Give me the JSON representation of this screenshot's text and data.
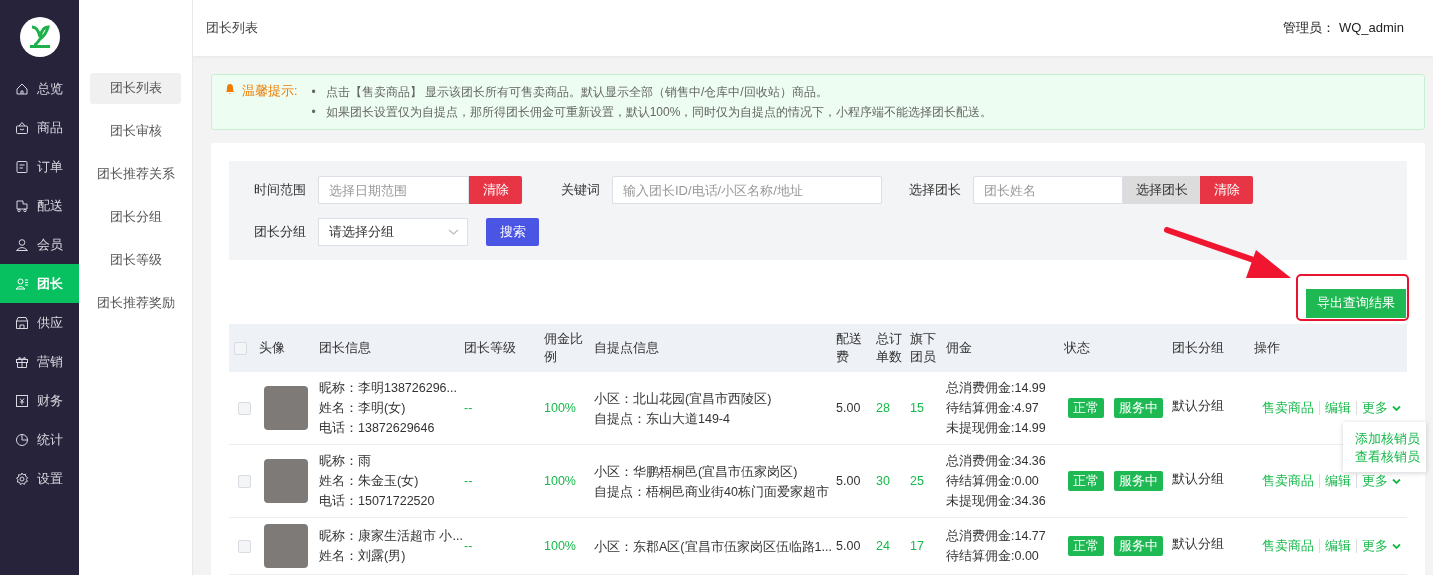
{
  "sidebar": {
    "items": [
      {
        "label": "总览",
        "kind": "home",
        "selected": false
      },
      {
        "label": "商品",
        "kind": "bag",
        "selected": false
      },
      {
        "label": "订单",
        "kind": "order",
        "selected": false
      },
      {
        "label": "配送",
        "kind": "truck",
        "selected": false
      },
      {
        "label": "会员",
        "kind": "user",
        "selected": false
      },
      {
        "label": "团长",
        "kind": "leader",
        "selected": true
      },
      {
        "label": "供应",
        "kind": "store",
        "selected": false
      },
      {
        "label": "营销",
        "kind": "gift",
        "selected": false
      },
      {
        "label": "财务",
        "kind": "finance",
        "selected": false
      },
      {
        "label": "统计",
        "kind": "chart",
        "selected": false
      },
      {
        "label": "设置",
        "kind": "gear",
        "selected": false
      }
    ]
  },
  "subnav": {
    "items": [
      {
        "label": "团长列表",
        "selected": true
      },
      {
        "label": "团长审核",
        "selected": false
      },
      {
        "label": "团长推荐关系",
        "selected": false
      },
      {
        "label": "团长分组",
        "selected": false
      },
      {
        "label": "团长等级",
        "selected": false
      },
      {
        "label": "团长推荐奖励",
        "selected": false
      }
    ]
  },
  "header": {
    "title": "团长列表",
    "admin": "管理员： WQ_admin"
  },
  "notice": {
    "title": "温馨提示:",
    "bullet": "•",
    "items": [
      "点击【售卖商品】 显示该团长所有可售卖商品。默认显示全部（销售中/仓库中/回收站）商品。",
      "如果团长设置仅为自提点，那所得团长佣金可重新设置，默认100%，同时仅为自提点的情况下，小程序端不能选择团长配送。"
    ]
  },
  "filters": {
    "time_label": "时间范围",
    "time_placeholder": "选择日期范围",
    "time_clear": "清除",
    "keyword_label": "关键词",
    "keyword_placeholder": "输入团长ID/电话/小区名称/地址",
    "leader_label": "选择团长",
    "leader_placeholder": "团长姓名",
    "leader_select": "选择团长",
    "leader_clear": "清除",
    "group_label": "团长分组",
    "group_value": "请选择分组",
    "search": "搜索"
  },
  "export_button": "导出查询结果",
  "table": {
    "header_checked": false,
    "columns": [
      "头像",
      "团长信息",
      "团长等级",
      "佣金比例",
      "自提点信息",
      "配送费",
      "总订单数",
      "旗下团员",
      "佣金",
      "状态",
      "团长分组",
      "操作"
    ],
    "rows": [
      {
        "checked": false,
        "info": [
          "昵称：李明138726296...",
          "姓名：李明(女)",
          "电话：13872629646"
        ],
        "level": "--",
        "ratio": "100%",
        "pickup": [
          "小区：北山花园(宜昌市西陵区)",
          "自提点：东山大道149-4"
        ],
        "delivery_fee": "5.00",
        "orders": "28",
        "members": "15",
        "commission": [
          "总消费佣金:14.99",
          "待结算佣金:4.97",
          "未提现佣金:14.99"
        ],
        "tags": [
          "正常",
          "服务中"
        ],
        "group": "默认分组",
        "actions": [
          "售卖商品",
          "编辑",
          "更多"
        ]
      },
      {
        "checked": false,
        "info": [
          "昵称：雨",
          "姓名：朱金玉(女)",
          "电话：15071722520"
        ],
        "level": "--",
        "ratio": "100%",
        "pickup": [
          "小区：华鹏梧桐邑(宜昌市伍家岗区)",
          "自提点：梧桐邑商业街40栋门面爱家超市"
        ],
        "delivery_fee": "5.00",
        "orders": "30",
        "members": "25",
        "commission": [
          "总消费佣金:34.36",
          "待结算佣金:0.00",
          "未提现佣金:34.36"
        ],
        "tags": [
          "正常",
          "服务中"
        ],
        "group": "默认分组",
        "actions": [
          "售卖商品",
          "编辑",
          "更多"
        ]
      },
      {
        "checked": false,
        "info": [
          "昵称：康家生活超市 小...",
          "姓名：刘露(男)"
        ],
        "level": "--",
        "ratio": "100%",
        "pickup": [
          "小区：东郡A区(宜昌市伍家岗区伍临路1..."
        ],
        "delivery_fee": "5.00",
        "orders": "24",
        "members": "17",
        "commission": [
          "总消费佣金:14.77",
          "待结算佣金:0.00"
        ],
        "tags": [
          "正常",
          "服务中"
        ],
        "group": "默认分组",
        "actions": [
          "售卖商品",
          "编辑",
          "更多"
        ]
      }
    ]
  },
  "dropdown_menu": {
    "items": [
      "添加核销员",
      "查看核销员"
    ]
  }
}
